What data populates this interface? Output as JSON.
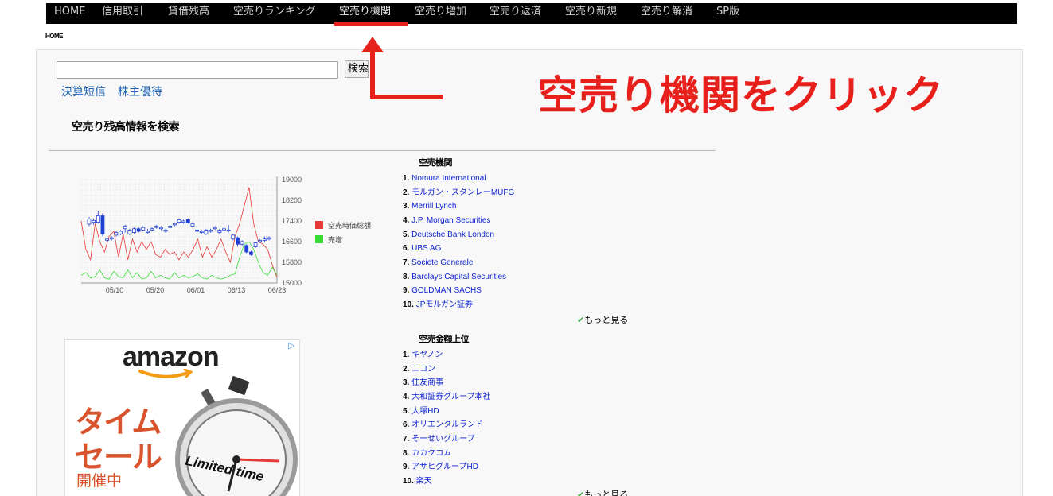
{
  "nav": {
    "items": [
      "HOME",
      "信用取引",
      "貸借残高",
      "空売りランキング",
      "空売り機関",
      "空売り増加",
      "空売り返済",
      "空売り新規",
      "空売り解消",
      "SP版"
    ]
  },
  "breadcrumb": "HOME",
  "search": {
    "placeholder": "",
    "value": "",
    "button_label": "検索"
  },
  "text_links": [
    "決算短信",
    "株主優待"
  ],
  "section_heading": "空売り残高情報を検索",
  "chart_data": {
    "type": "line",
    "x_ticks": [
      "05/10",
      "05/20",
      "06/01",
      "06/13",
      "06/23"
    ],
    "y_ticks": [
      19000,
      18200,
      17400,
      16600,
      15800,
      15000
    ],
    "ylim": [
      15000,
      19000
    ],
    "legend": [
      {
        "name": "空売時価総額",
        "color": "#e53935"
      },
      {
        "name": "売増",
        "color": "#33dd33"
      }
    ],
    "legend_position": "right",
    "grid": true,
    "series": [
      {
        "name": "空売時価総額",
        "color": "#e53935",
        "values": [
          17400,
          16300,
          15900,
          17300,
          16600,
          16200,
          16800,
          17000,
          16000,
          16900,
          15900,
          16700,
          16200,
          16600,
          16300,
          16600,
          16100,
          16000,
          16300,
          16100,
          16200,
          15900,
          16200,
          16000,
          16300,
          16700,
          16000,
          16400,
          16000,
          16300,
          16700,
          16200,
          15800,
          16800,
          17300,
          18000,
          18700,
          17300,
          16600,
          16500,
          16300,
          15700,
          15200
        ]
      },
      {
        "name": "売増",
        "color": "#33dd33",
        "values": [
          15300,
          15400,
          15200,
          15250,
          15500,
          15200,
          15150,
          15450,
          15250,
          15200,
          15500,
          15200,
          15400,
          15150,
          15200,
          15450,
          15200,
          15300,
          15200,
          15150,
          15400,
          15200,
          15300,
          15200,
          15250,
          15350,
          15200,
          15150,
          15300,
          15200,
          15150,
          15200,
          15300,
          15350,
          16000,
          16500,
          16600,
          16300,
          15800,
          15400,
          15300,
          15600,
          15300
        ]
      }
    ],
    "candles": [
      [
        17280,
        17480,
        17200,
        17550
      ],
      [
        17350,
        17420,
        17250,
        17500
      ],
      [
        17350,
        17600,
        17300,
        17800
      ],
      [
        17600,
        16900,
        16800,
        17700
      ],
      [
        16650,
        16700,
        16600,
        16750
      ],
      [
        16700,
        16750,
        16650,
        16800
      ],
      [
        16850,
        16950,
        16800,
        17000
      ],
      [
        16900,
        17000,
        16850,
        17050
      ],
      [
        17100,
        17200,
        16950,
        17250
      ],
      [
        16900,
        17050,
        16850,
        17100
      ],
      [
        16950,
        17100,
        16900,
        17150
      ],
      [
        17100,
        17000,
        16950,
        17150
      ],
      [
        17050,
        17150,
        17000,
        17200
      ],
      [
        16950,
        17000,
        16900,
        17100
      ],
      [
        17050,
        17100,
        17000,
        17150
      ],
      [
        17150,
        17200,
        17100,
        17250
      ],
      [
        17100,
        17150,
        17050,
        17200
      ],
      [
        17000,
        17050,
        16950,
        17100
      ],
      [
        17150,
        17200,
        17100,
        17250
      ],
      [
        17250,
        17300,
        17200,
        17350
      ],
      [
        17350,
        17450,
        17300,
        17500
      ],
      [
        17350,
        17400,
        17300,
        17450
      ],
      [
        17450,
        17350,
        17300,
        17500
      ],
      [
        17200,
        17300,
        17150,
        17350
      ],
      [
        17050,
        17000,
        16950,
        17100
      ],
      [
        16950,
        17000,
        16900,
        17050
      ],
      [
        16900,
        17050,
        16850,
        17100
      ],
      [
        17000,
        17050,
        16950,
        17100
      ],
      [
        17100,
        17150,
        17050,
        17200
      ],
      [
        16950,
        17050,
        16900,
        17100
      ],
      [
        17050,
        17100,
        17000,
        17150
      ],
      [
        17050,
        17050,
        16950,
        17250
      ],
      [
        16700,
        16850,
        16650,
        16900
      ],
      [
        16750,
        16500,
        16400,
        16800
      ],
      [
        16500,
        16600,
        16450,
        16650
      ],
      [
        16450,
        16200,
        16150,
        16500
      ],
      [
        16200,
        16100,
        16050,
        16250
      ],
      [
        16400,
        16550,
        16350,
        16600
      ],
      [
        16600,
        16650,
        16550,
        16700
      ],
      [
        16650,
        16700,
        16600,
        16800
      ],
      [
        16700,
        16750,
        16650,
        16800
      ]
    ]
  },
  "list1": {
    "title": "空売機関",
    "items": [
      "Nomura International",
      "モルガン・スタンレーMUFG",
      "Merrill Lynch",
      "J.P. Morgan Securities",
      "Deutsche Bank London",
      "UBS AG",
      "Societe Generale",
      "Barclays Capital Securities",
      "GOLDMAN SACHS",
      "JPモルガン証券"
    ],
    "more": "もっと見る"
  },
  "list2": {
    "title": "空売金額上位",
    "items": [
      "キヤノン",
      "ニコン",
      "住友商事",
      "大和証券グループ本社",
      "大塚HD",
      "オリエンタルランド",
      "そーせいグループ",
      "カカクコム",
      "アサヒグループHD",
      "楽天"
    ],
    "more": "もっと見る"
  },
  "ad": {
    "brand": "amazon",
    "line1": "タイム",
    "line2": "セール",
    "line3": "開催中",
    "badge": "Limited time"
  },
  "annotation": "空売り機関をクリック",
  "colors": {
    "nav_bg": "#000000",
    "link": "#0a1fd1",
    "annotation": "#e8201c"
  }
}
